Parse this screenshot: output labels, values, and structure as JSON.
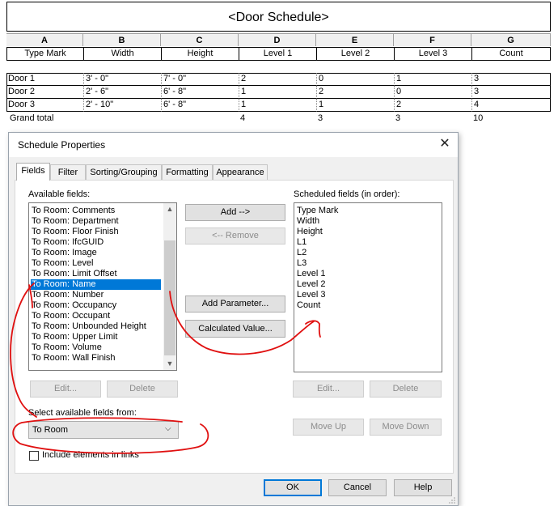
{
  "schedule": {
    "title": "<Door Schedule>",
    "column_letters": [
      "A",
      "B",
      "C",
      "D",
      "E",
      "F",
      "G"
    ],
    "headers": [
      "Type Mark",
      "Width",
      "Height",
      "Level 1",
      "Level 2",
      "Level 3",
      "Count"
    ],
    "rows": [
      [
        "Door 1",
        "3' - 0\"",
        "7' - 0\"",
        "2",
        "0",
        "1",
        "3"
      ],
      [
        "Door 2",
        "2' - 6\"",
        "6' - 8\"",
        "1",
        "2",
        "0",
        "3"
      ],
      [
        "Door 3",
        "2' - 10\"",
        "6' - 8\"",
        "1",
        "1",
        "2",
        "4"
      ]
    ],
    "grand_total": [
      "Grand total",
      "",
      "",
      "4",
      "3",
      "3",
      "10"
    ]
  },
  "dialog": {
    "title": "Schedule Properties",
    "close_icon": "close-icon",
    "tabs": [
      "Fields",
      "Filter",
      "Sorting/Grouping",
      "Formatting",
      "Appearance"
    ],
    "active_tab": "Fields",
    "available_label": "Available fields:",
    "available_fields": [
      "To Room: Comments",
      "To Room: Department",
      "To Room: Floor Finish",
      "To Room: IfcGUID",
      "To Room: Image",
      "To Room: Level",
      "To Room: Limit Offset",
      "To Room: Name",
      "To Room: Number",
      "To Room: Occupancy",
      "To Room: Occupant",
      "To Room: Unbounded Height",
      "To Room: Upper Limit",
      "To Room: Volume",
      "To Room: Wall Finish"
    ],
    "selected_available": "To Room: Name",
    "scheduled_label": "Scheduled fields (in order):",
    "scheduled_fields": [
      "Type Mark",
      "Width",
      "Height",
      "L1",
      "L2",
      "L3",
      "Level 1",
      "Level 2",
      "Level 3",
      "Count"
    ],
    "buttons": {
      "add": "Add -->",
      "remove": "<-- Remove",
      "add_parameter": "Add Parameter...",
      "calculated_value": "Calculated Value...",
      "edit_left": "Edit...",
      "delete_left": "Delete",
      "edit_right": "Edit...",
      "delete_right": "Delete",
      "move_up": "Move Up",
      "move_down": "Move Down",
      "ok": "OK",
      "cancel": "Cancel",
      "help": "Help"
    },
    "select_from_label": "Select available fields from:",
    "select_from_value": "To Room",
    "include_links_label": "Include elements in links",
    "include_links_checked": false
  },
  "annotation_color": "#e01010"
}
